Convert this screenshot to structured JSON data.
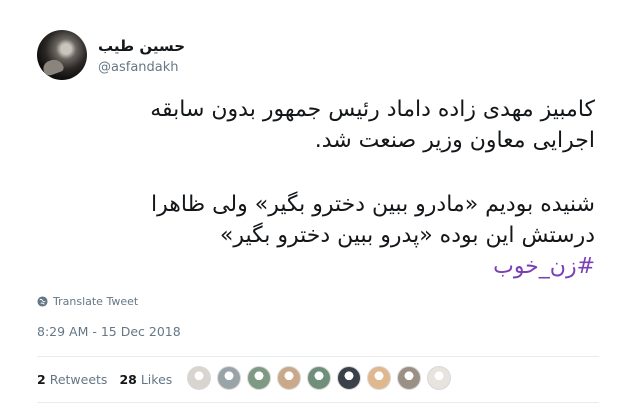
{
  "tweet": {
    "display_name": "حسین طیب",
    "username": "@asfandakh",
    "lines": [
      "کامبیز مهدی زاده داماد رئیس جمهور بدون سابقه",
      "اجرایی معاون وزیر صنعت شد.",
      "شنیده بودیم «مادرو ببین دخترو بگیر» ولی ظاهرا",
      "درستش این بوده «پدرو ببین دخترو بگیر»"
    ],
    "hashtag": "#زن_خوب",
    "translate_label": "Translate Tweet",
    "timestamp": "8:29 AM - 15 Dec 2018"
  },
  "stats": {
    "retweets_count": "2",
    "retweets_label": "Retweets",
    "likes_count": "28",
    "likes_label": "Likes"
  },
  "likers": [
    {
      "name": "liker-avatar-1",
      "color": "#d8d4cf"
    },
    {
      "name": "liker-avatar-2",
      "color": "#9aa3a7"
    },
    {
      "name": "liker-avatar-3",
      "color": "#7f9a84"
    },
    {
      "name": "liker-avatar-4",
      "color": "#c9a98a"
    },
    {
      "name": "liker-avatar-5",
      "color": "#6f8f7b"
    },
    {
      "name": "liker-avatar-6",
      "color": "#3b4149"
    },
    {
      "name": "liker-avatar-7",
      "color": "#e0b88e"
    },
    {
      "name": "liker-avatar-8",
      "color": "#9b9086"
    },
    {
      "name": "liker-avatar-9",
      "color": "#e7e3de"
    }
  ],
  "colors": {
    "hashtag": "#7b3fb5",
    "secondary_text": "#657786"
  }
}
